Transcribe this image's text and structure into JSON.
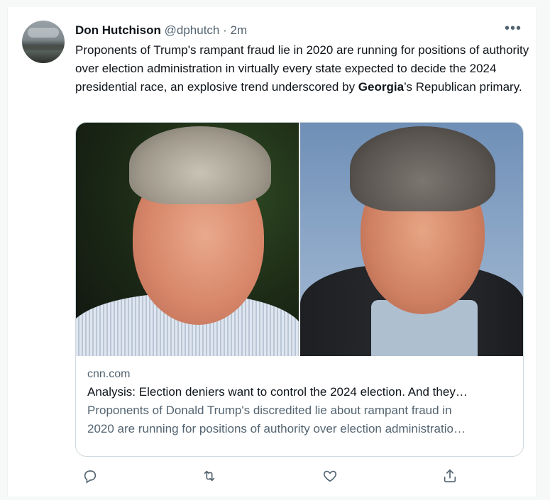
{
  "tweet": {
    "author_name": "Don Hutchison",
    "author_handle": "@dphutch",
    "separator": "·",
    "time": "2m",
    "more_label": "•••",
    "text_part1": "Proponents of Trump's rampant fraud lie in 2020 are running for positions of authority over election administration in virtually every state expected to decide the 2024 presidential race, an explosive trend  underscored by ",
    "text_bold": "Georgia",
    "text_part2": "’s Republican primary."
  },
  "card": {
    "domain": "cnn.com",
    "title": "Analysis: Election deniers want to control the 2024 election. And they…",
    "description_line1": "Proponents of Donald Trump's discredited lie about rampant fraud in",
    "description_line2": "2020 are running for positions of authority over election administratio…"
  },
  "actions": {
    "reply_icon": "reply-icon",
    "retweet_icon": "retweet-icon",
    "like_icon": "like-icon",
    "share_icon": "share-icon"
  },
  "colors": {
    "text": "#0f1419",
    "secondary": "#536471",
    "border": "#cfd9de",
    "background": "#f7f9f9"
  }
}
